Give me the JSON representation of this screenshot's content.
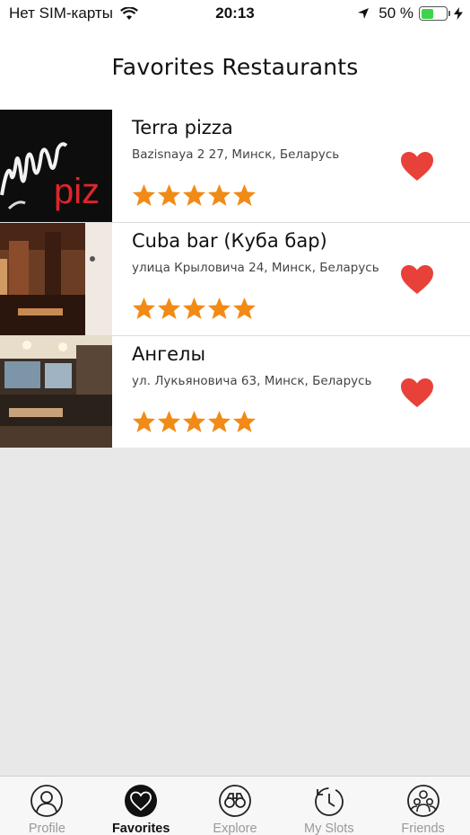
{
  "status_bar": {
    "carrier": "Нет SIM-карты",
    "time": "20:13",
    "battery_percent": "50 %",
    "battery_level": 0.5,
    "icons": [
      "wifi-icon",
      "location-arrow-icon",
      "battery-icon",
      "charging-bolt-icon"
    ]
  },
  "header": {
    "title": "Favorites Restaurants"
  },
  "colors": {
    "star": "#f28a16",
    "heart": "#e8413a",
    "battery": "#3fd34b",
    "active_tab": "#111111",
    "inactive_tab": "#9a9a9a"
  },
  "restaurants": [
    {
      "name": "Terra pizza",
      "address": "Bazisnaya 2 27, Минск, Беларусь",
      "rating": 5,
      "favorite": true
    },
    {
      "name": "Cuba bar (Куба бар)",
      "address": "улица Крыловича 24, Минск, Беларусь",
      "rating": 5,
      "favorite": true
    },
    {
      "name": "Ангелы",
      "address": "ул. Лукьяновича 63, Минск, Беларусь",
      "rating": 5,
      "favorite": true
    }
  ],
  "tabs": [
    {
      "label": "Profile",
      "icon": "profile-icon",
      "active": false
    },
    {
      "label": "Favorites",
      "icon": "heart-icon",
      "active": true
    },
    {
      "label": "Explore",
      "icon": "binoculars-icon",
      "active": false
    },
    {
      "label": "My Slots",
      "icon": "history-clock-icon",
      "active": false
    },
    {
      "label": "Friends",
      "icon": "friends-icon",
      "active": false
    }
  ]
}
